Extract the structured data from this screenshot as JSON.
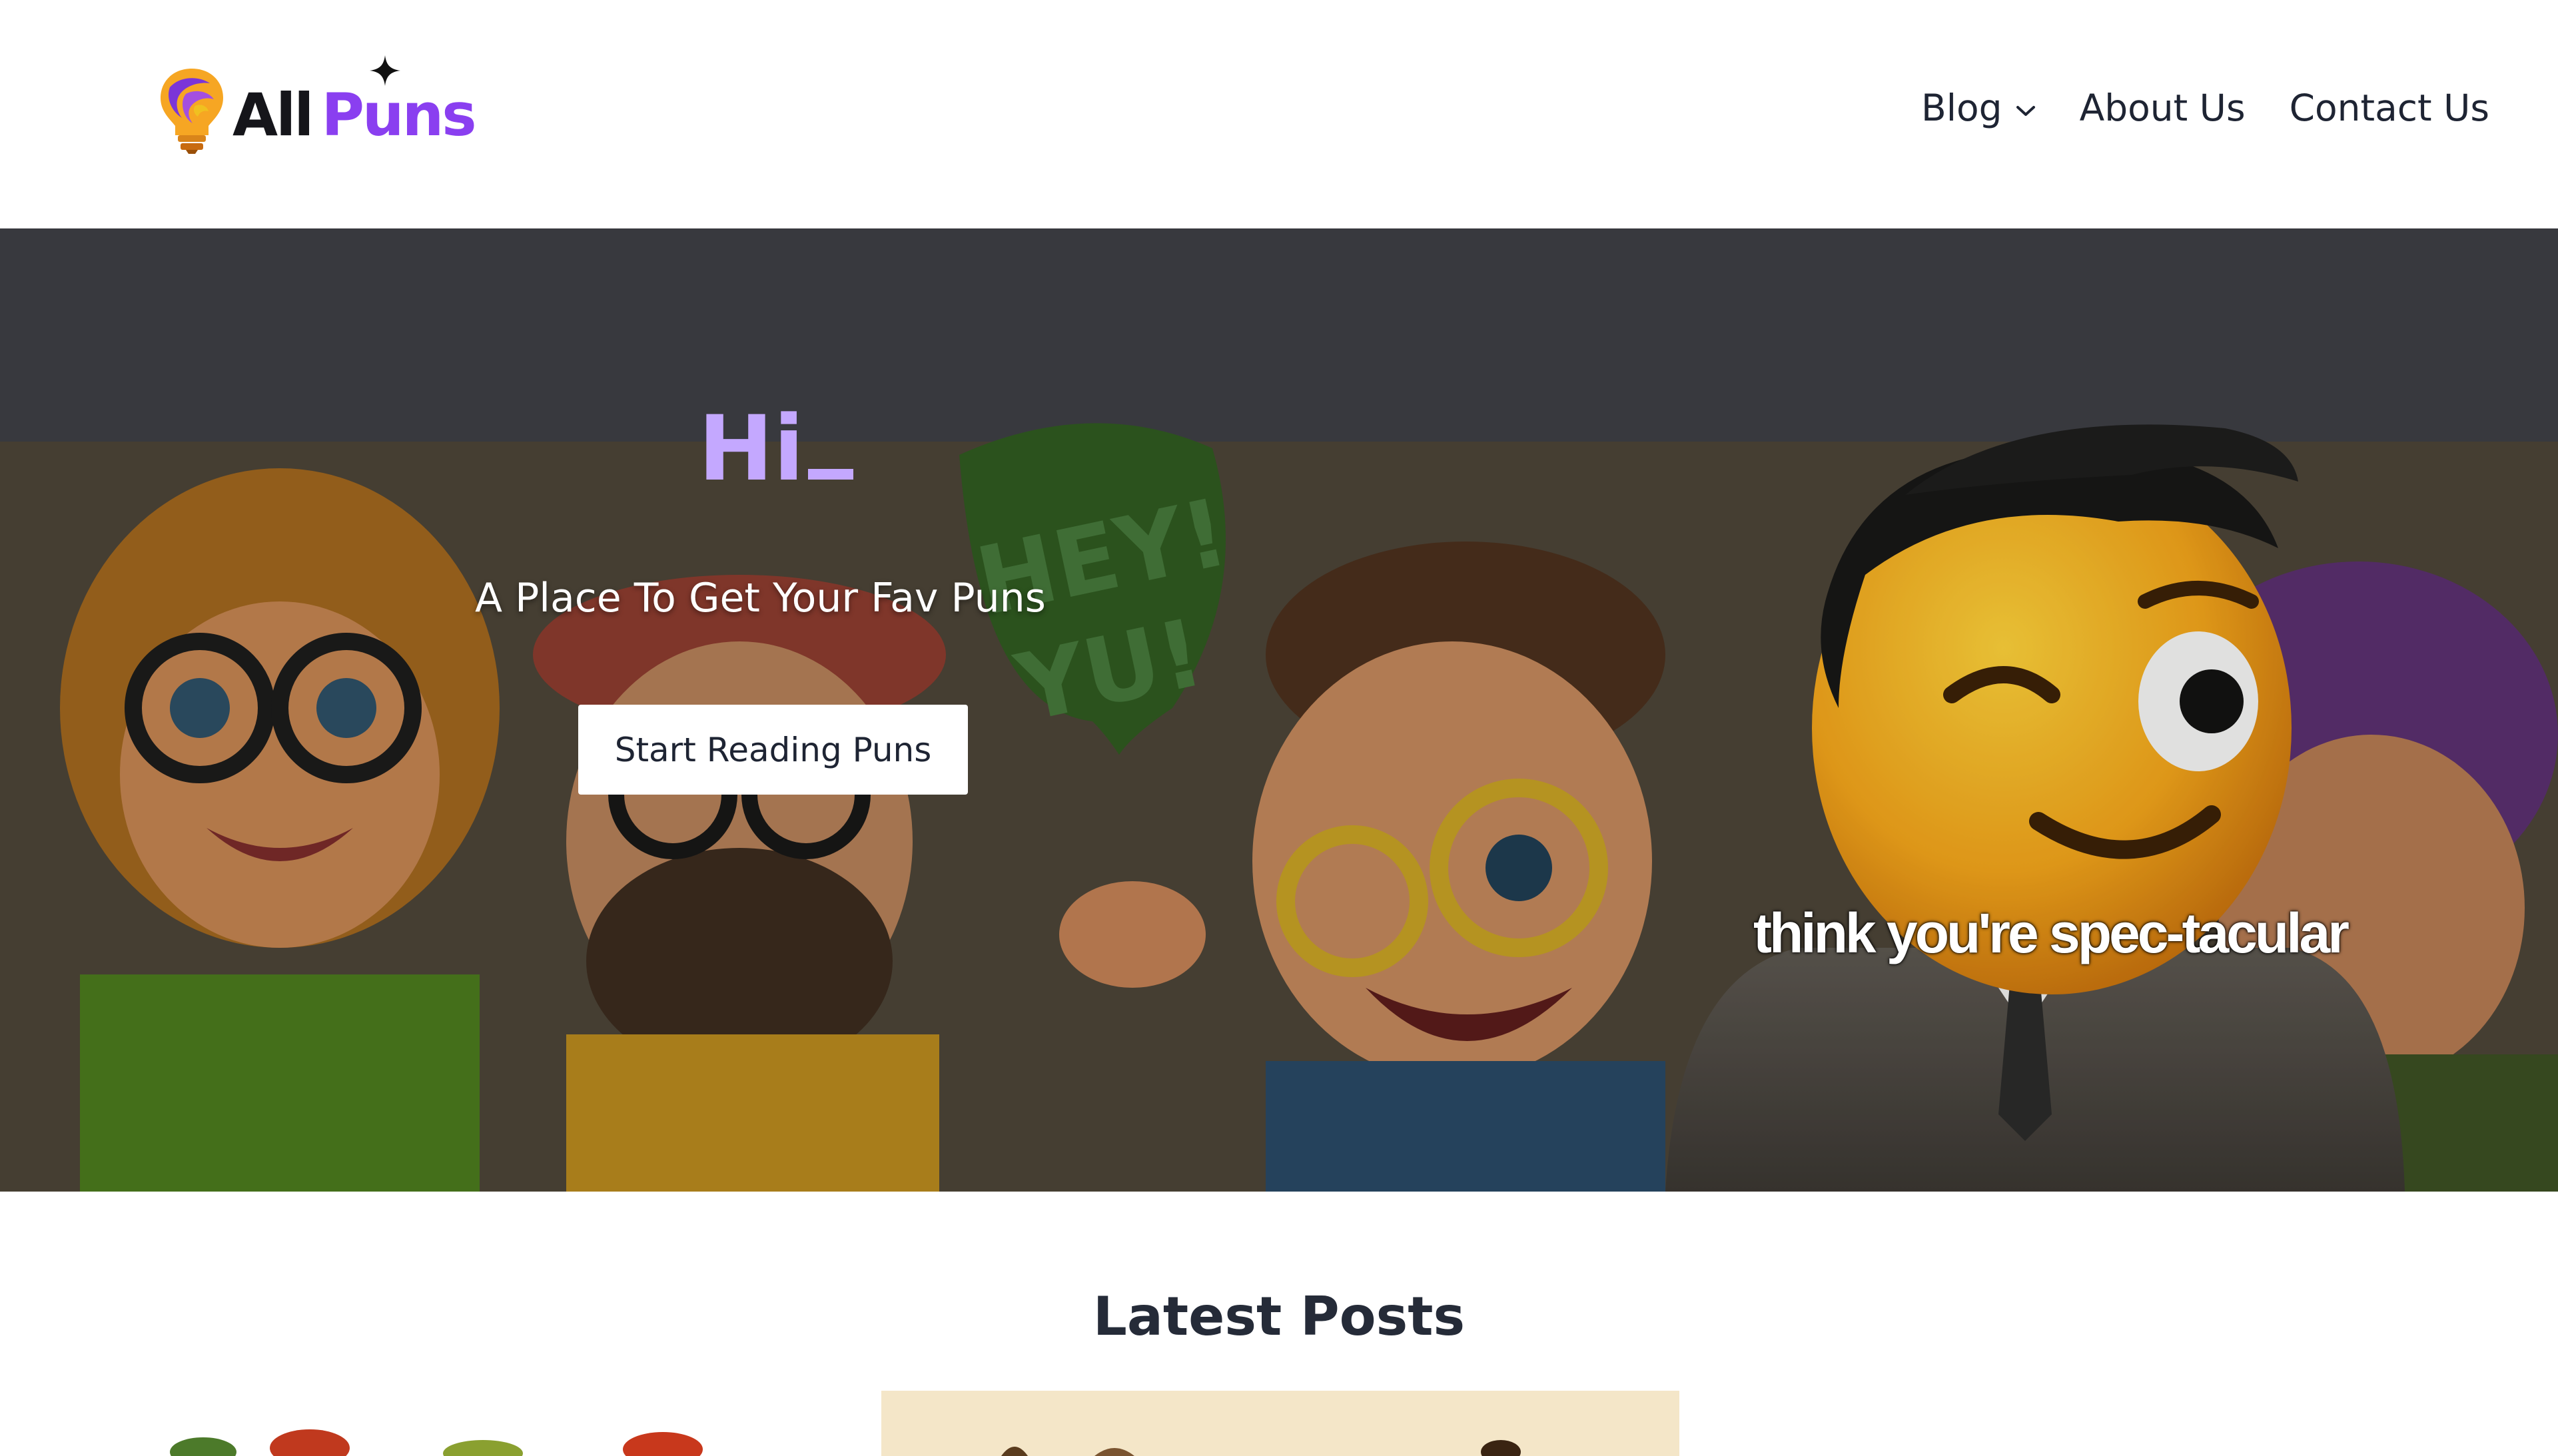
{
  "site": {
    "logo": {
      "word_primary": "All",
      "word_accent": "Puns",
      "accent_color": "#8a3ff0",
      "icon": "lightbulb-logo-icon"
    }
  },
  "nav": {
    "items": [
      {
        "label": "Blog",
        "has_dropdown": true,
        "icon": "chevron-down-icon"
      },
      {
        "label": "About Us",
        "has_dropdown": false
      },
      {
        "label": "Contact Us",
        "has_dropdown": false
      }
    ]
  },
  "hero": {
    "title": "Hi",
    "subtitle": "A Place To Get Your Fav Puns",
    "cta_label": "Start Reading Puns",
    "image_caption": "think you're spec-tacular",
    "title_color": "#c4a8ff"
  },
  "latest": {
    "heading": "Latest Posts"
  }
}
